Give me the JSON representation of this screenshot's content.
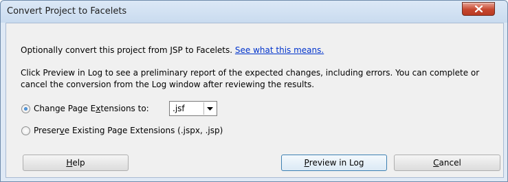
{
  "window": {
    "title": "Convert Project to Facelets"
  },
  "body": {
    "intro_text": "Optionally convert this project from JSP to Facelets. ",
    "intro_link": "See what this means.",
    "description": "Click Preview in Log to see a preliminary report of the expected  changes, including errors. You can complete or cancel the conversion from the Log window after reviewing the results."
  },
  "options": {
    "change_ext": {
      "label_pre": "Change Page E",
      "label_mnemonic": "x",
      "label_post": "tensions to:",
      "selected": true
    },
    "extension_value": ".jsf",
    "preserve_ext": {
      "label_pre": "Preser",
      "label_mnemonic": "v",
      "label_post": "e Existing Page Extensions (.jspx, .jsp)",
      "selected": false
    }
  },
  "buttons": {
    "help": {
      "mnemonic": "H",
      "rest": "elp"
    },
    "preview": {
      "mnemonic": "P",
      "rest": "review in Log"
    },
    "cancel": {
      "mnemonic": "C",
      "rest": "ancel"
    }
  },
  "colors": {
    "link": "#0033cc",
    "close_button": "#c7472f",
    "dialog_background": "#f0f0f0"
  },
  "icons": {
    "close": "close-icon",
    "dropdown": "chevron-down-icon"
  }
}
